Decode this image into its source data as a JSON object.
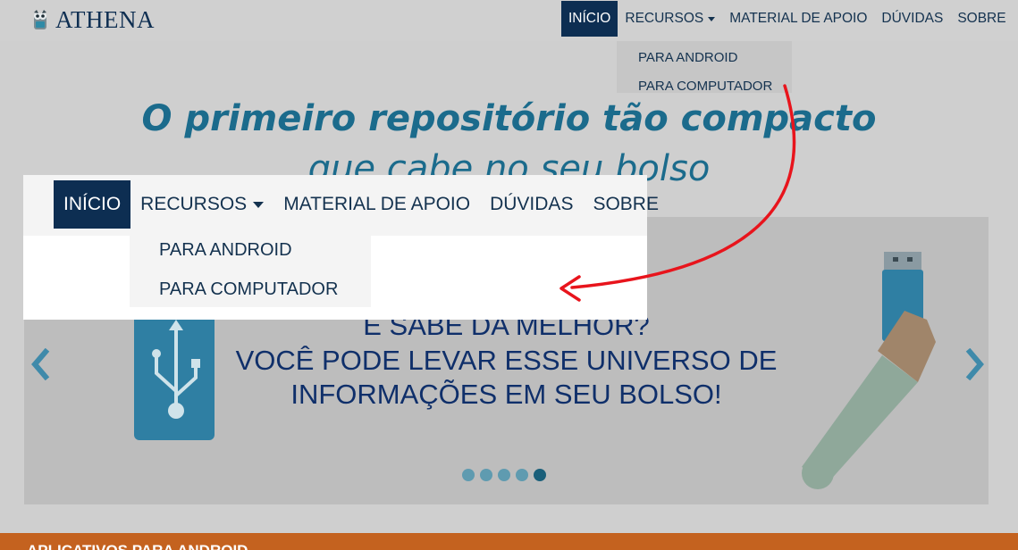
{
  "brand": {
    "name": "ATHENA",
    "logo_icon": "owl-icon"
  },
  "nav": {
    "items": [
      {
        "label": "INÍCIO",
        "active": true
      },
      {
        "label": "RECURSOS",
        "dropdown": true
      },
      {
        "label": "MATERIAL DE APOIO"
      },
      {
        "label": "DÚVIDAS"
      },
      {
        "label": "SOBRE"
      }
    ],
    "dropdown_items": [
      {
        "label": "PARA ANDROID"
      },
      {
        "label": "PARA COMPUTADOR"
      }
    ]
  },
  "hero": {
    "line1": "O primeiro repositório tão compacto",
    "line2": "que cabe no seu bolso"
  },
  "carousel": {
    "line1": "E SABE DA MELHOR?",
    "line2": "VOCÊ PODE LEVAR ESSE UNIVERSO DE",
    "line3": "INFORMAÇÕES EM SEU BOLSO!",
    "slide_count": 5,
    "active_slide": 5,
    "prev_icon": "chevron-left-icon",
    "next_icon": "chevron-right-icon"
  },
  "section": {
    "title": "APLICATIVOS PARA ANDROID"
  },
  "colors": {
    "nav_active": "#0d2e52",
    "hero_text": "#1b6b8c",
    "accent_band": "#c4621f",
    "annotation_arrow": "#e8141c"
  }
}
